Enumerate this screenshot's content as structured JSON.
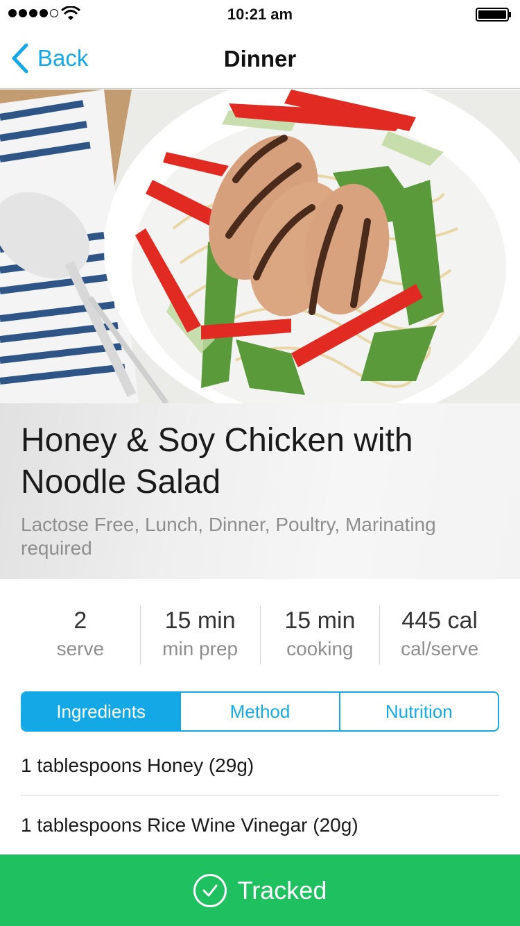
{
  "status_bar": {
    "time": "10:21 am",
    "signal_bars": 4,
    "signal_total": 5
  },
  "nav": {
    "back_label": "Back",
    "title": "Dinner"
  },
  "hero": {
    "image": "honey-soy-chicken-noodle-salad-photo"
  },
  "recipe": {
    "title": "Honey & Soy Chicken with Noodle Salad",
    "tags": "Lactose Free, Lunch, Dinner, Poultry, Marinating required"
  },
  "stats": [
    {
      "value": "2",
      "label": "serve"
    },
    {
      "value": "15 min",
      "label": "min prep"
    },
    {
      "value": "15 min",
      "label": "cooking"
    },
    {
      "value": "445 cal",
      "label": "cal/serve"
    }
  ],
  "tabs": [
    {
      "label": "Ingredients",
      "active": true
    },
    {
      "label": "Method",
      "active": false
    },
    {
      "label": "Nutrition",
      "active": false
    }
  ],
  "ingredients": [
    "1 tablespoons Honey (29g)",
    "1 tablespoons Rice Wine Vinegar (20g)"
  ],
  "tracked": {
    "label": "Tracked",
    "icon": "check-icon"
  },
  "colors": {
    "accent": "#14a9e6",
    "tracked": "#1ec05f",
    "tag_text": "#8e8e8e"
  }
}
